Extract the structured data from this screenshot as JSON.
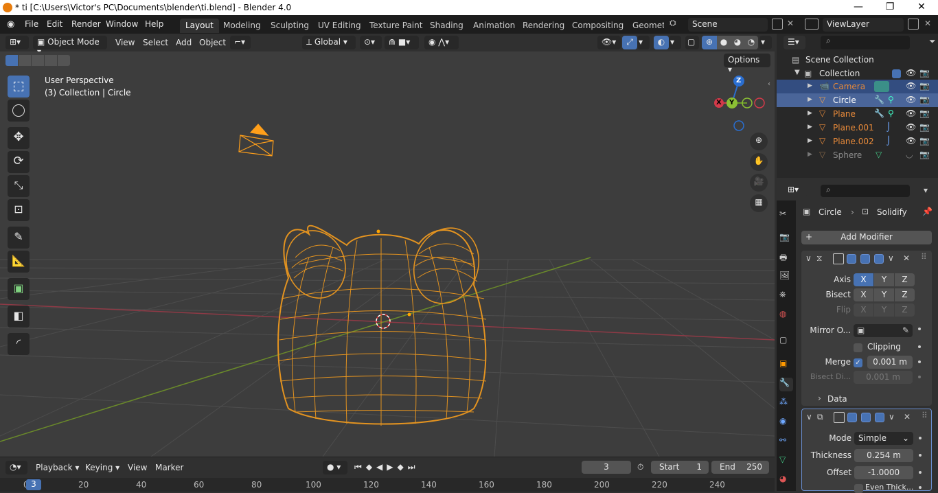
{
  "window": {
    "title": "* ti [C:\\Users\\Victor's PC\\Documents\\blender\\ti.blend] - Blender 4.0",
    "minimize": "—",
    "restore": "❐",
    "close": "✕"
  },
  "menu": [
    "File",
    "Edit",
    "Render",
    "Window",
    "Help"
  ],
  "workspaces": [
    "Layout",
    "Modeling",
    "Sculpting",
    "UV Editing",
    "Texture Paint",
    "Shading",
    "Animation",
    "Rendering",
    "Compositing",
    "Geomet"
  ],
  "scene": {
    "name": "Scene",
    "view_layer": "ViewLayer"
  },
  "viewport_header": {
    "mode": "Object Mode",
    "view": "View",
    "select": "Select",
    "add": "Add",
    "object": "Object",
    "transform": "Global",
    "options": "Options"
  },
  "viewport": {
    "perspective": "User Perspective",
    "context": "(3) Collection | Circle",
    "gizmo": {
      "z": "Z",
      "y": "Y",
      "x": "X"
    }
  },
  "outliner": {
    "root": "Scene Collection",
    "collection": "Collection",
    "items": [
      {
        "name": "Camera",
        "color": "#e88a3a",
        "selected": true
      },
      {
        "name": "Circle",
        "color": "#f0a050",
        "selected": true
      },
      {
        "name": "Plane",
        "color": "#e88a3a",
        "selected": false
      },
      {
        "name": "Plane.001",
        "color": "#e88a3a",
        "selected": false
      },
      {
        "name": "Plane.002",
        "color": "#e88a3a",
        "selected": false
      },
      {
        "name": "Sphere",
        "color": "#8a8a8a",
        "selected": false
      }
    ]
  },
  "properties": {
    "breadcrumb_object": "Circle",
    "breadcrumb_modifier": "Solidify",
    "add_modifier": "Add Modifier",
    "mirror": {
      "axis_label": "Axis",
      "bisect_label": "Bisect",
      "flip_label": "Flip",
      "axes": [
        "X",
        "Y",
        "Z"
      ],
      "mirror_object_label": "Mirror O...",
      "clipping_label": "Clipping",
      "merge_label": "Merge",
      "merge_value": "0.001 m",
      "bisect_distance_label": "Bisect Di...",
      "bisect_distance_value": "0.001 m",
      "data_label": "Data"
    },
    "solidify": {
      "mode_label": "Mode",
      "mode_value": "Simple",
      "thickness_label": "Thickness",
      "thickness_value": "0.254 m",
      "offset_label": "Offset",
      "offset_value": "-1.0000",
      "even_label": "Even Thick..."
    }
  },
  "timeline": {
    "playback": "Playback",
    "keying": "Keying",
    "view": "View",
    "marker": "Marker",
    "current_frame": "3",
    "start_label": "Start",
    "start": "1",
    "end_label": "End",
    "end": "250",
    "ruler": [
      "0",
      "20",
      "40",
      "60",
      "80",
      "100",
      "120",
      "140",
      "160",
      "180",
      "200",
      "220",
      "240"
    ],
    "playhead": "3"
  },
  "colors": {
    "accent": "#4772b3",
    "selection": "#ffa500",
    "bg": "#303030"
  }
}
